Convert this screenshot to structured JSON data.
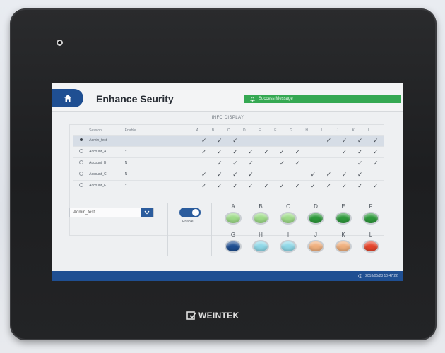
{
  "header": {
    "title": "Enhance Seurity",
    "success_message": "Success Message"
  },
  "info_display": {
    "label": "INFO DISPLAY",
    "columns": [
      "Session",
      "Enable",
      "A",
      "B",
      "C",
      "D",
      "E",
      "F",
      "G",
      "H",
      "I",
      "J",
      "K",
      "L"
    ],
    "rows": [
      {
        "selected": true,
        "session": "Admin_test",
        "enable": "",
        "checks": [
          1,
          1,
          1,
          0,
          0,
          0,
          0,
          0,
          1,
          1,
          1,
          1
        ]
      },
      {
        "selected": false,
        "session": "Account_A",
        "enable": "Y",
        "checks": [
          1,
          1,
          1,
          1,
          1,
          1,
          1,
          0,
          0,
          1,
          1,
          1
        ]
      },
      {
        "selected": false,
        "session": "Account_B",
        "enable": "N",
        "checks": [
          0,
          1,
          1,
          1,
          0,
          1,
          1,
          0,
          0,
          0,
          1,
          1
        ]
      },
      {
        "selected": false,
        "session": "Account_C",
        "enable": "N",
        "checks": [
          1,
          1,
          1,
          1,
          0,
          0,
          0,
          1,
          1,
          1,
          1,
          0
        ]
      },
      {
        "selected": false,
        "session": "Account_F",
        "enable": "Y",
        "checks": [
          1,
          1,
          1,
          1,
          1,
          1,
          1,
          1,
          1,
          1,
          1,
          1
        ]
      }
    ]
  },
  "account_select": {
    "value": "Admin_test"
  },
  "toggle": {
    "label": "Enable",
    "on": true
  },
  "lamps": [
    {
      "letter": "A",
      "color": "#9fdc8a"
    },
    {
      "letter": "B",
      "color": "#9fdc8a"
    },
    {
      "letter": "C",
      "color": "#9fdc8a"
    },
    {
      "letter": "D",
      "color": "#2e9a3c"
    },
    {
      "letter": "E",
      "color": "#2e9a3c"
    },
    {
      "letter": "F",
      "color": "#2e9a3c"
    },
    {
      "letter": "G",
      "color": "#1f4f92"
    },
    {
      "letter": "H",
      "color": "#8fd8e8"
    },
    {
      "letter": "I",
      "color": "#8fd8e8"
    },
    {
      "letter": "J",
      "color": "#f0b07e"
    },
    {
      "letter": "K",
      "color": "#f0b07e"
    },
    {
      "letter": "L",
      "color": "#e6452c"
    }
  ],
  "statusbar": {
    "text": "2018/05/23 10:47:22"
  },
  "device": {
    "brand": "WEINTEK"
  },
  "colors": {
    "accent": "#1f4f92",
    "success": "#35a852"
  }
}
